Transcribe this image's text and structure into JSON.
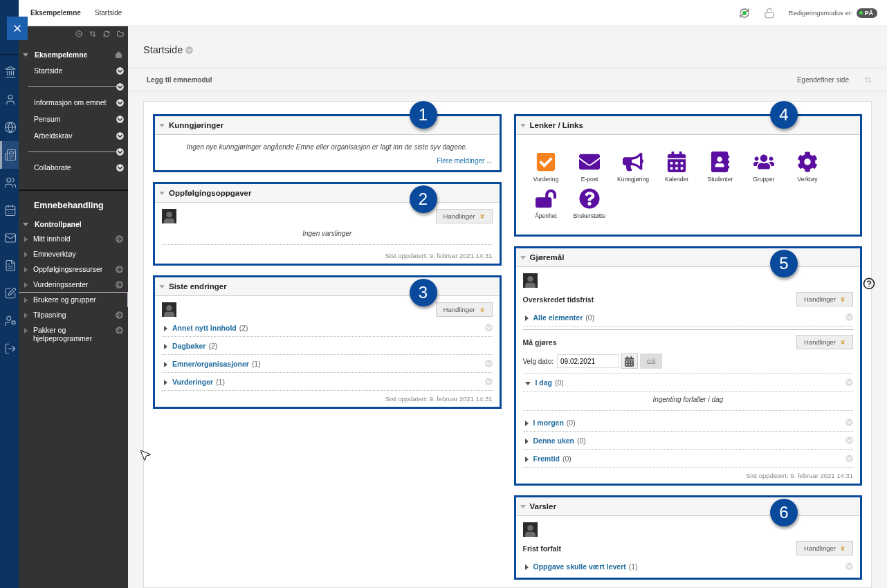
{
  "top_bar": {
    "breadcrumbs": [
      "Eksempelemne",
      "Startside"
    ],
    "edit_mode_label": "Redigeringsmodus er:",
    "edit_mode": {
      "label": "PÅ",
      "on": true
    }
  },
  "rail": [
    {
      "kind": "institution",
      "selected": false
    },
    {
      "kind": "profile",
      "selected": false
    },
    {
      "kind": "globe",
      "selected": false
    },
    {
      "kind": "courses",
      "selected": true
    },
    {
      "kind": "groups",
      "selected": false
    },
    {
      "kind": "calendar",
      "selected": false
    },
    {
      "kind": "messages",
      "selected": false
    },
    {
      "kind": "grades",
      "selected": false
    },
    {
      "kind": "tools",
      "selected": false
    },
    {
      "kind": "user-settings",
      "selected": false
    },
    {
      "kind": "logout",
      "selected": false
    }
  ],
  "course_menu": {
    "title": "Eksempelemne",
    "items": [
      {
        "kind": "link",
        "label": "Startside"
      },
      {
        "kind": "divider"
      },
      {
        "kind": "link",
        "label": "Informasjon om emnet"
      },
      {
        "kind": "link",
        "label": "Pensum"
      },
      {
        "kind": "link",
        "label": "Arbeidskrav"
      },
      {
        "kind": "divider"
      },
      {
        "kind": "link",
        "label": "Collaborate"
      }
    ]
  },
  "management": {
    "title": "Emnebehandling",
    "panel_title": "Kontrollpanel",
    "items": [
      {
        "label": "Mitt innhold",
        "arrow": true,
        "selected": false
      },
      {
        "label": "Emneverktøy",
        "arrow": false,
        "selected": false
      },
      {
        "label": "Oppfølgingsressurser",
        "arrow": true,
        "selected": false
      },
      {
        "label": "Vurderingssenter",
        "arrow": true,
        "selected": false
      },
      {
        "label": "Brukere og grupper",
        "arrow": false,
        "selected": true
      },
      {
        "label": "Tilpasning",
        "arrow": true,
        "selected": false
      },
      {
        "label": "Pakker og hjelpeprogrammer",
        "arrow": true,
        "selected": false
      }
    ]
  },
  "page": {
    "title": "Startside",
    "add_module": "Legg til emnemodul",
    "customize": "Egendefiner side"
  },
  "columns": [
    [
      {
        "title": "Kunngjøringer",
        "badge": "1",
        "blocks": [
          {
            "kind": "message",
            "text": "Ingen nye kunngjøringer angående Emne eller organisasjon er lagt inn de siste syv dagene."
          },
          {
            "kind": "link",
            "text": "Flere meldinger ..."
          }
        ]
      },
      {
        "title": "Oppfølgingsoppgaver",
        "badge": "2",
        "blocks": [
          {
            "kind": "avatar",
            "action": "Handlinger"
          },
          {
            "kind": "message",
            "text": "Ingen varslinger"
          },
          {
            "kind": "divider"
          },
          {
            "kind": "updated",
            "text": "Sist oppdatert: 9. februar 2021 14:31"
          }
        ]
      },
      {
        "title": "Siste endringer",
        "badge": "3",
        "blocks": [
          {
            "kind": "avatar",
            "action": "Handlinger"
          },
          {
            "kind": "entry",
            "label": "Annet nytt innhold",
            "count": "(2)",
            "expanded": false,
            "menu": true
          },
          {
            "kind": "entry",
            "label": "Dagbøker",
            "count": "(2)",
            "expanded": false,
            "menu": false
          },
          {
            "kind": "entry",
            "label": "Emner/organisasjoner",
            "count": "(1)",
            "expanded": false,
            "menu": true
          },
          {
            "kind": "entry",
            "label": "Vurderinger",
            "count": "(1)",
            "expanded": false,
            "menu": true
          },
          {
            "kind": "updated",
            "text": "Sist oppdatert: 9. februar 2021 14:31"
          }
        ]
      }
    ],
    [
      {
        "title": "Lenker / Links",
        "badge": "4",
        "blocks": [
          {
            "kind": "tiles",
            "tiles": [
              {
                "kind": "check",
                "label": "Vurdering",
                "color": "#f5821f"
              },
              {
                "kind": "mail",
                "label": "E-post",
                "color": "#5a0fa0"
              },
              {
                "kind": "megaphone",
                "label": "Kunngjøring",
                "color": "#5a0fa0"
              },
              {
                "kind": "calendar",
                "label": "Kalender",
                "color": "#5a0fa0"
              },
              {
                "kind": "contacts",
                "label": "Studenter",
                "color": "#5a0fa0"
              },
              {
                "kind": "users",
                "label": "Grupper",
                "color": "#5a0fa0"
              },
              {
                "kind": "gear",
                "label": "Verktøy",
                "color": "#5a0fa0"
              },
              {
                "kind": "unlock",
                "label": "Åpenhet",
                "color": "#5a0fa0"
              },
              {
                "kind": "help",
                "label": "Brukerstøtte",
                "color": "#5a0fa0"
              }
            ]
          }
        ]
      },
      {
        "title": "Gjøremål",
        "badge": "5",
        "help_icon": true,
        "blocks": [
          {
            "kind": "avatar"
          },
          {
            "kind": "heading",
            "text": "Overskredet tidsfrist",
            "action": "Handlinger"
          },
          {
            "kind": "entry",
            "label": "Alle elementer",
            "count": "(0)",
            "expanded": false,
            "menu": true
          },
          {
            "kind": "rule"
          },
          {
            "kind": "heading",
            "text": "Må gjøres",
            "action": "Handlinger"
          },
          {
            "kind": "date",
            "label": "Velg dato:",
            "value": "09.02.2021",
            "go": "Gå"
          },
          {
            "kind": "entry",
            "label": "I dag",
            "count": "(0)",
            "expanded": true,
            "menu": true
          },
          {
            "kind": "message",
            "text": "Ingenting forfaller i dag"
          },
          {
            "kind": "divider"
          },
          {
            "kind": "entry",
            "label": "I morgen",
            "count": "(0)",
            "expanded": false,
            "menu": true
          },
          {
            "kind": "entry",
            "label": "Denne uken",
            "count": "(0)",
            "expanded": false,
            "menu": true
          },
          {
            "kind": "entry",
            "label": "Fremtid",
            "count": "(0)",
            "expanded": false,
            "menu": true
          },
          {
            "kind": "updated",
            "text": "Sist oppdatert: 9. februar 2021 14:31"
          }
        ]
      },
      {
        "title": "Varsler",
        "badge": "6",
        "blocks": [
          {
            "kind": "avatar"
          },
          {
            "kind": "heading",
            "text": "Frist forfalt",
            "action": "Handlinger"
          },
          {
            "kind": "entry",
            "label": "Oppgave skulle vært levert",
            "count": "(1)",
            "expanded": false,
            "menu": true
          }
        ]
      }
    ]
  ]
}
